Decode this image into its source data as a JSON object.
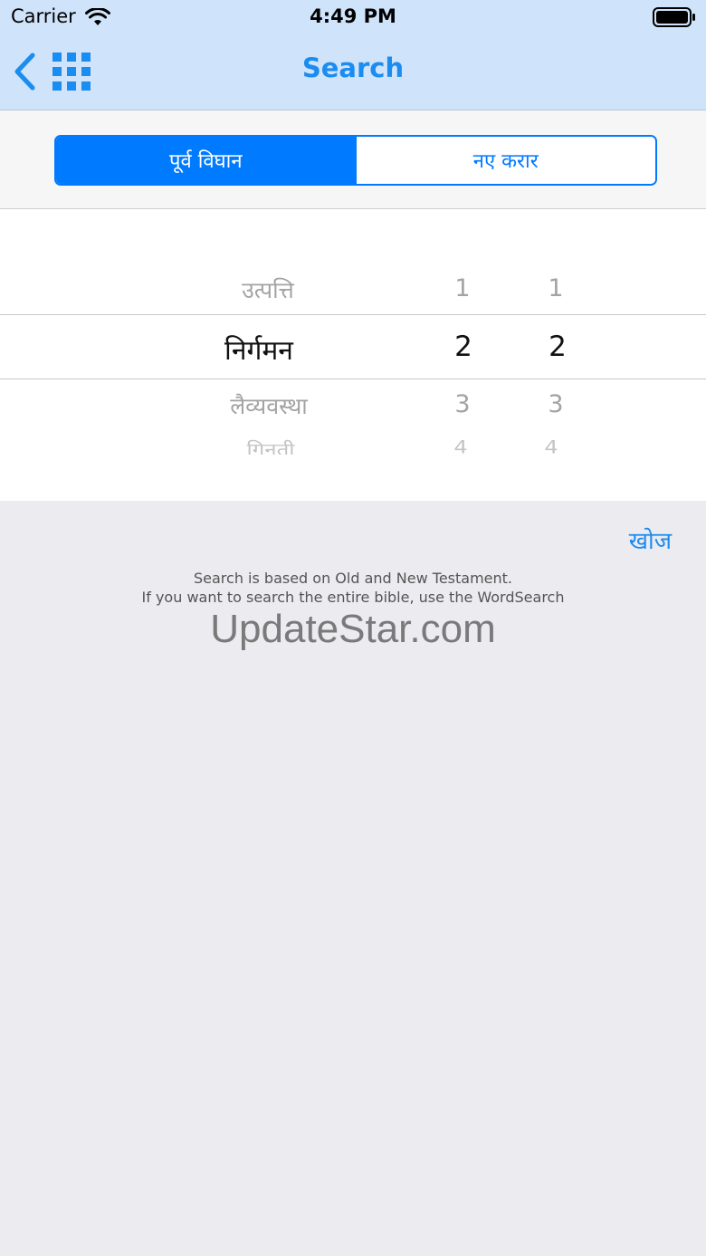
{
  "status_bar": {
    "carrier": "Carrier",
    "time": "4:49 PM",
    "wifi_icon": "wifi-icon",
    "battery_icon": "battery-icon"
  },
  "nav_bar": {
    "title": "Search",
    "back_icon": "chevron-left-icon",
    "menu_icon": "grid-icon",
    "accent_color": "#1b8cf0",
    "background": "#cfe3fa"
  },
  "segments": {
    "options": [
      "पूर्व विघान",
      "नए करार"
    ],
    "selected_index": 0,
    "color": "#007aff"
  },
  "picker": {
    "selected": {
      "book": "निर्गमन",
      "chapter": "2",
      "verse": "2"
    },
    "rows": [
      {
        "book": "उत्पत्ति",
        "chapter": "1",
        "verse": "1"
      },
      {
        "book": "निर्गमन",
        "chapter": "2",
        "verse": "2"
      },
      {
        "book": "लैव्यवस्था",
        "chapter": "3",
        "verse": "3"
      },
      {
        "book": "गिनती",
        "chapter": "4",
        "verse": "4"
      }
    ]
  },
  "search_button": {
    "label": "खोज"
  },
  "info": {
    "line1": "Search is based on Old and New Testament.",
    "line2": "If you want to search the entire bible, use the WordSearch"
  },
  "watermark": "UpdateStar.com"
}
